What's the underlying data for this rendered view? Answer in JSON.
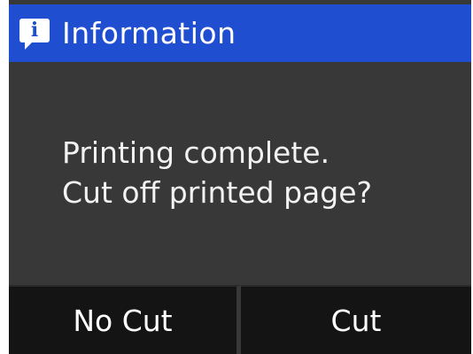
{
  "header": {
    "title": "Information",
    "icon": "info-icon",
    "icon_glyph": "i",
    "color": "#1f4fd0"
  },
  "message": {
    "line1": "Printing complete.",
    "line2": "Cut off printed page?"
  },
  "buttons": {
    "no_cut": "No Cut",
    "cut": "Cut"
  },
  "colors": {
    "background": "#383838",
    "button_bg": "#141414",
    "text": "#ffffff"
  }
}
